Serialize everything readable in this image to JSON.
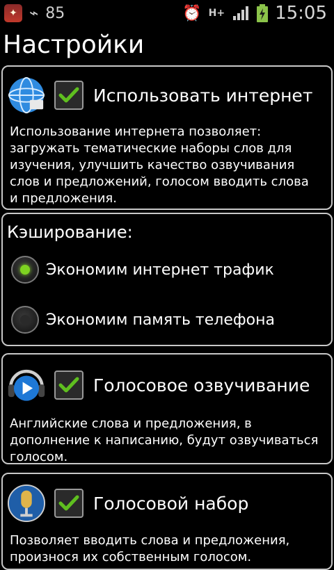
{
  "status_bar": {
    "signal_text": "85",
    "network_type": "H+",
    "time": "15:05"
  },
  "page": {
    "title": "Настройки"
  },
  "internet": {
    "title": "Использовать интернет",
    "description": "Использование интернета позволяет:\nзагружать тематические наборы слов для\nизучения, улучшить качество озвучивания\nслов и предложений, голосом вводить слова\nи предложения.",
    "checked": true
  },
  "caching": {
    "label": "Кэширование:",
    "options": [
      {
        "label": "Экономим интернет трафик",
        "selected": true
      },
      {
        "label": "Экономим память телефона",
        "selected": false
      }
    ]
  },
  "voice_over": {
    "title": "Голосовое озвучивание",
    "description": "Английские слова и предложения, в\nдополнение к написанию, будут озвучиваться\nголосом.",
    "checked": true
  },
  "voice_input": {
    "title": "Голосовой набор",
    "description": "Позволяет вводить слова и предложения,\nпроизнося их собственным голосом.",
    "checked": true
  },
  "colors": {
    "check_green": "#5fbf1f",
    "radio_selected": "#7ed321",
    "border": "#c8c8c8"
  }
}
